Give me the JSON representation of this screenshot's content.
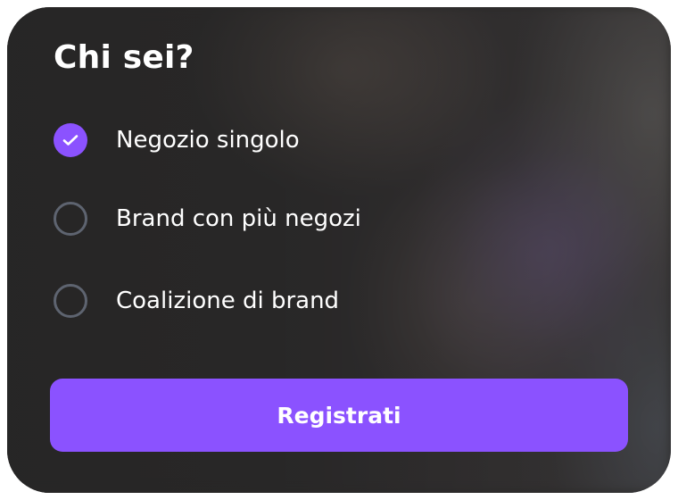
{
  "form": {
    "title": "Chi sei?",
    "options": [
      {
        "label": "Negozio singolo",
        "checked": true
      },
      {
        "label": "Brand con più negozi",
        "checked": false
      },
      {
        "label": "Coalizione di brand",
        "checked": false
      }
    ],
    "submit_label": "Registrati"
  },
  "icons": {
    "selected": "check-icon"
  },
  "colors": {
    "accent": "#8b52ff",
    "radio_border": "#5e6470",
    "card_background": "#2b2a29",
    "text": "#ffffff"
  }
}
